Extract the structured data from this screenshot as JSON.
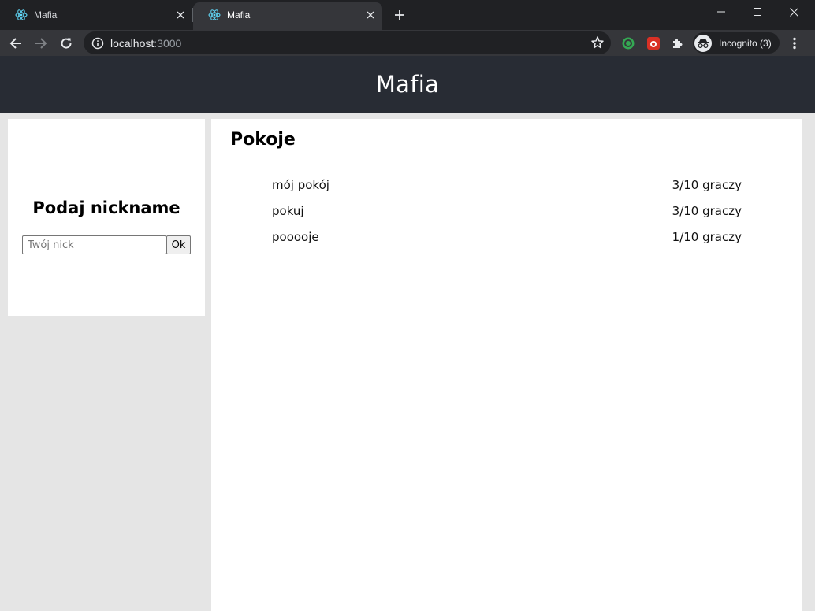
{
  "browser": {
    "tabs": [
      {
        "title": "Mafia",
        "active": false,
        "icon": "react-icon"
      },
      {
        "title": "Mafia",
        "active": true,
        "icon": "react-icon"
      }
    ],
    "address": {
      "host": "localhost",
      "port": ":3000"
    },
    "profile_label": "Incognito (3)",
    "icons": [
      "back-icon",
      "forward-icon",
      "reload-icon",
      "info-icon",
      "star-icon",
      "extension-icon",
      "puzzle-icon",
      "incognito-icon",
      "kebab-menu-icon"
    ]
  },
  "app": {
    "title": "Mafia"
  },
  "nickname": {
    "heading": "Podaj nickname",
    "placeholder": "Twój nick",
    "value": "",
    "ok_label": "Ok"
  },
  "rooms": {
    "heading": "Pokoje",
    "items": [
      {
        "name": "mój pokój",
        "players": "3/10 graczy"
      },
      {
        "name": "pokuj",
        "players": "3/10 graczy"
      },
      {
        "name": "pooooje",
        "players": "1/10 graczy"
      }
    ]
  },
  "colors": {
    "header_bg": "#282c34",
    "page_bg": "#e5e5e5",
    "panel_bg": "#ffffff",
    "chrome_frame": "#202124",
    "chrome_toolbar": "#35363a"
  }
}
